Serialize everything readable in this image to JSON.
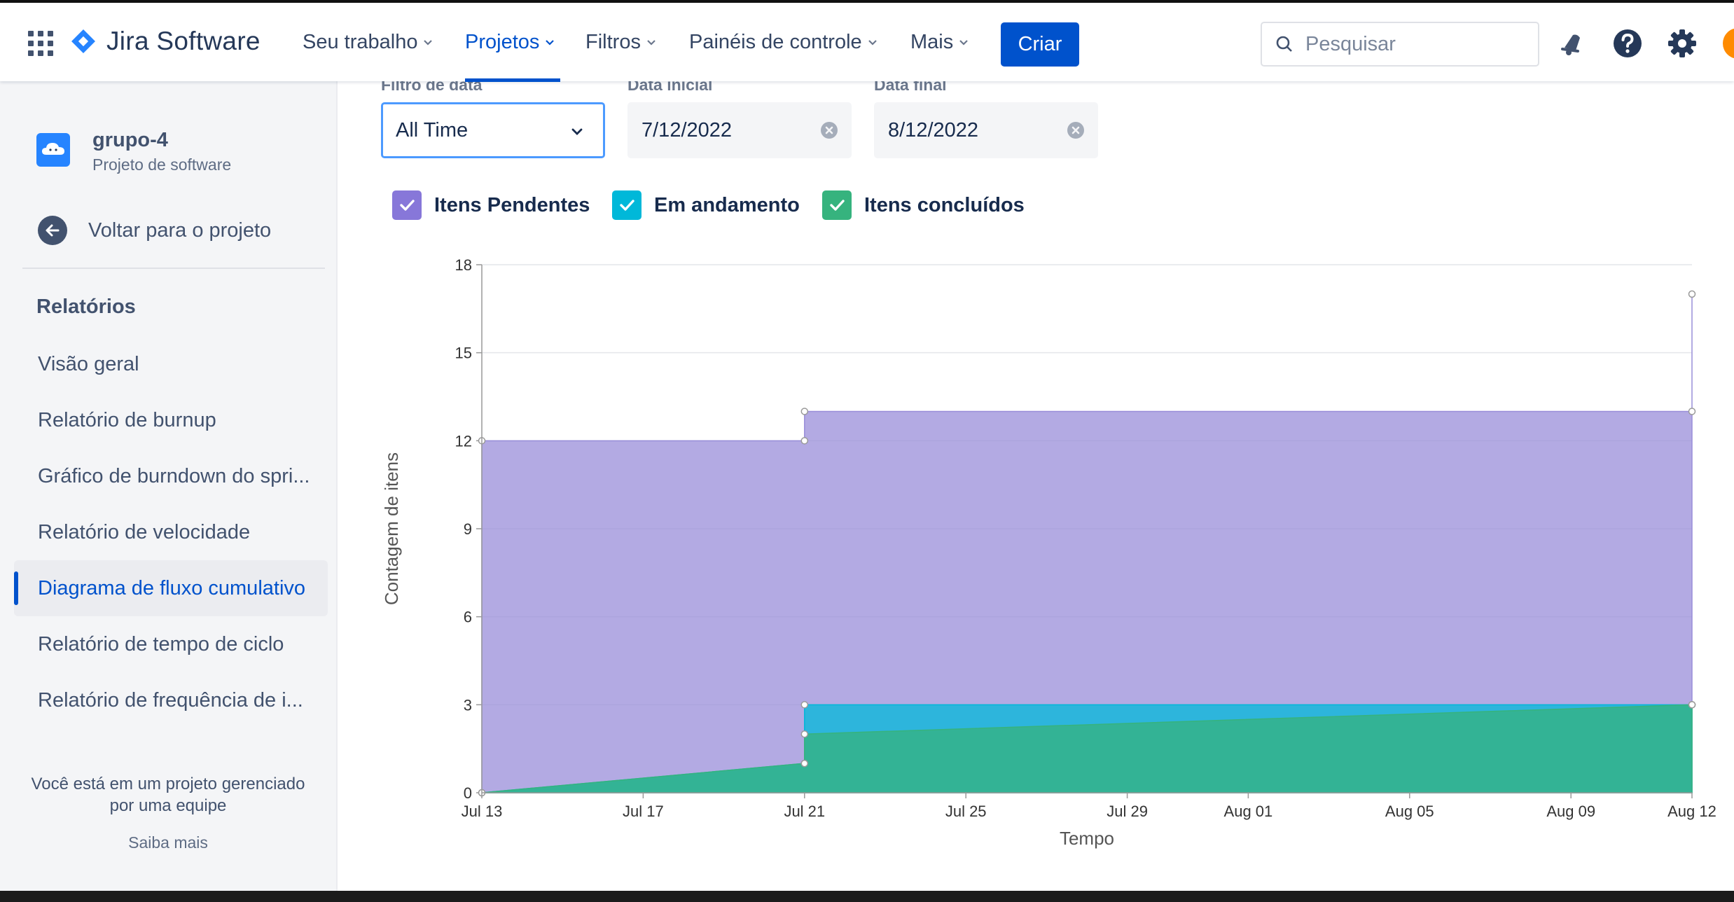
{
  "topbar": {
    "product_name": "Jira Software",
    "nav": [
      {
        "label": "Seu trabalho"
      },
      {
        "label": "Projetos"
      },
      {
        "label": "Filtros"
      },
      {
        "label": "Painéis de controle"
      },
      {
        "label": "Mais"
      }
    ],
    "create_label": "Criar",
    "search_placeholder": "Pesquisar"
  },
  "sidebar": {
    "project_name": "grupo-4",
    "project_type": "Projeto de software",
    "back_label": "Voltar para o projeto",
    "section_heading": "Relatórios",
    "items": [
      {
        "label": "Visão geral"
      },
      {
        "label": "Relatório de burnup"
      },
      {
        "label": "Gráfico de burndown do spri..."
      },
      {
        "label": "Relatório de velocidade"
      },
      {
        "label": "Diagrama de fluxo cumulativo"
      },
      {
        "label": "Relatório de tempo de ciclo"
      },
      {
        "label": "Relatório de frequência de i..."
      }
    ],
    "footer_line1": "Você está em um projeto gerenciado",
    "footer_line2": "por uma equipe",
    "learn_more": "Saiba mais"
  },
  "filters": {
    "date_filter_label": "Filtro de data",
    "date_filter_value": "All Time",
    "start_label": "Data inicial",
    "start_value": "7/12/2022",
    "end_label": "Data final",
    "end_value": "8/12/2022"
  },
  "colors": {
    "pending": "#998dd9",
    "in_progress": "#00b8d9",
    "done": "#36b37e",
    "accent": "#0052cc"
  },
  "chart_data": {
    "type": "area",
    "xlabel": "Tempo",
    "ylabel": "Contagem de itens",
    "ylim": [
      0,
      18
    ],
    "xlim": [
      "2022-07-13",
      "2022-08-12"
    ],
    "y_ticks": [
      0,
      3,
      6,
      9,
      12,
      15,
      18
    ],
    "x_ticks": [
      {
        "date": "2022-07-13",
        "label": "Jul 13"
      },
      {
        "date": "2022-07-17",
        "label": "Jul 17"
      },
      {
        "date": "2022-07-21",
        "label": "Jul 21"
      },
      {
        "date": "2022-07-25",
        "label": "Jul 25"
      },
      {
        "date": "2022-07-29",
        "label": "Jul 29"
      },
      {
        "date": "2022-08-01",
        "label": "Aug 01"
      },
      {
        "date": "2022-08-05",
        "label": "Aug 05"
      },
      {
        "date": "2022-08-09",
        "label": "Aug 09"
      },
      {
        "date": "2022-08-12",
        "label": "Aug 12"
      }
    ],
    "grid": true,
    "x": [
      "2022-07-13",
      "2022-07-21",
      "2022-07-21",
      "2022-08-12",
      "2022-08-12"
    ],
    "series": [
      {
        "name": "Itens concluídos",
        "color": "#36b37e",
        "values": [
          0,
          1,
          2,
          3,
          3
        ]
      },
      {
        "name": "Em andamento",
        "color": "#00b8d9",
        "values": [
          0,
          1,
          3,
          3,
          3
        ]
      },
      {
        "name": "Itens Pendentes",
        "color": "#998dd9",
        "values": [
          12,
          12,
          13,
          13,
          17
        ]
      }
    ]
  }
}
